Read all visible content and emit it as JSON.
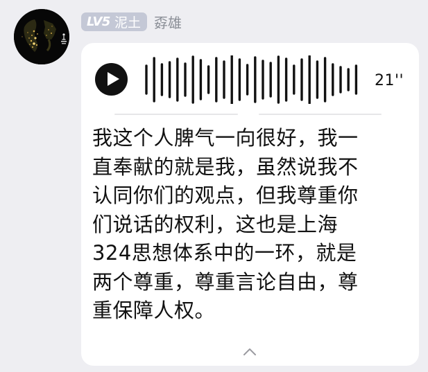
{
  "user": {
    "level": "LV5",
    "level_title": "泥土",
    "username": "孬雄",
    "avatar": "globe-map-avatar"
  },
  "voice_message": {
    "duration": "21''",
    "play_icon": "play-icon"
  },
  "post": {
    "text": "我这个人脾气一向很好，我一\n直奉献的就是我，虽然说我不\n认同你们的观点，但我尊重你\n们说话的权利，这也是上海\n324思想体系中的一环，就是\n两个尊重，尊重言论自由，尊\n重保障人权。"
  },
  "controls": {
    "collapse_icon": "chevron-up-icon"
  },
  "colors": {
    "background": "#eeeef2",
    "card": "#ffffff",
    "badge": "#c4c8d6",
    "username": "#8a8e96",
    "text": "#111111"
  }
}
